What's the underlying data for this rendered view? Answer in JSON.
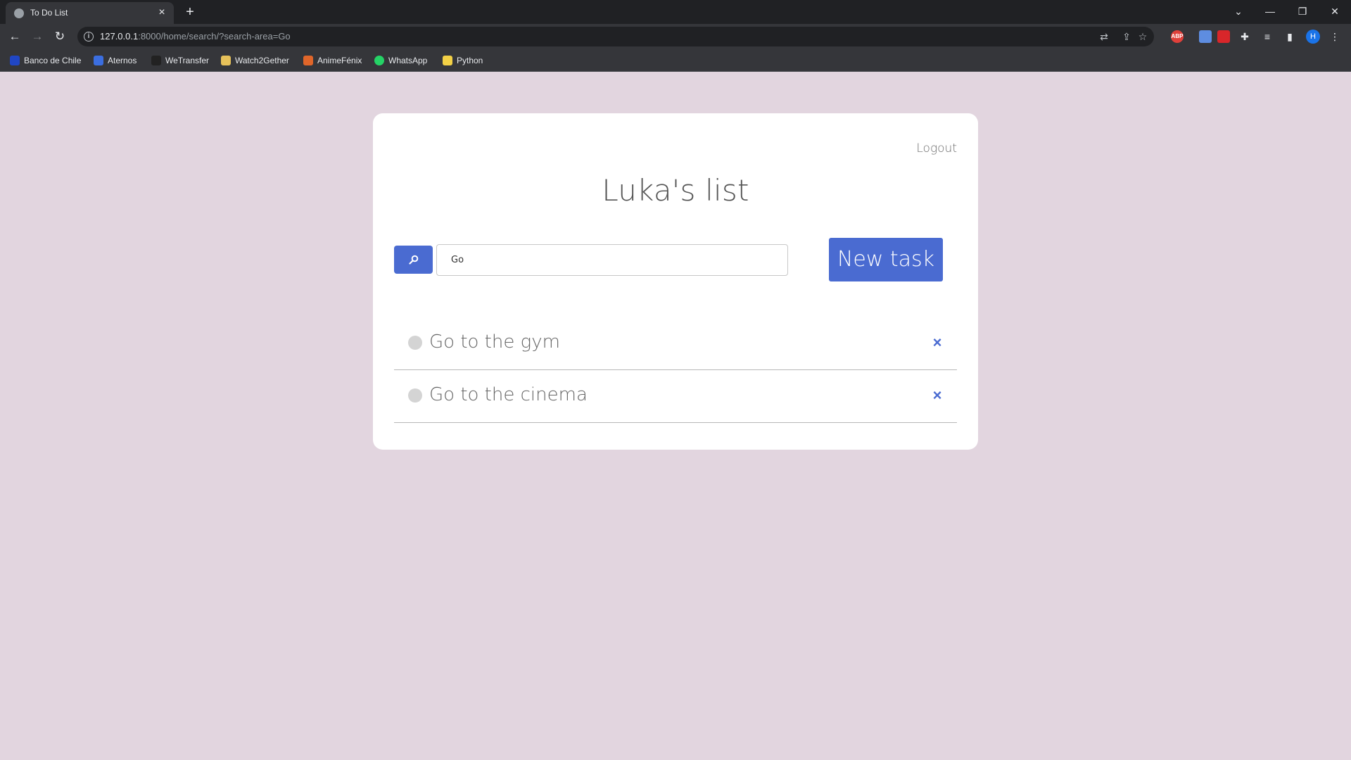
{
  "browser": {
    "tab_title": "To Do List",
    "url_host": "127.0.0.1",
    "url_rest": ":8000/home/search/?search-area=Go",
    "profile_initial": "H",
    "bookmarks": [
      {
        "label": "Banco de Chile",
        "color": "#2046c4"
      },
      {
        "label": "Aternos",
        "color": "#3b6ee0"
      },
      {
        "label": "WeTransfer",
        "color": "#222222"
      },
      {
        "label": "Watch2Gether",
        "color": "#e6c15a"
      },
      {
        "label": "AnimeFénix",
        "color": "#e0662a"
      },
      {
        "label": "WhatsApp",
        "color": "#25d366"
      },
      {
        "label": "Python",
        "color": "#f2d046"
      }
    ]
  },
  "page": {
    "logout_label": "Logout",
    "title": "Luka's list",
    "search_value": "Go",
    "new_task_label": "New task",
    "accent_color": "#4a6bd1",
    "background_color": "#e2d5df",
    "tasks": [
      {
        "text": "Go to the gym"
      },
      {
        "text": "Go to the cinema"
      }
    ]
  }
}
